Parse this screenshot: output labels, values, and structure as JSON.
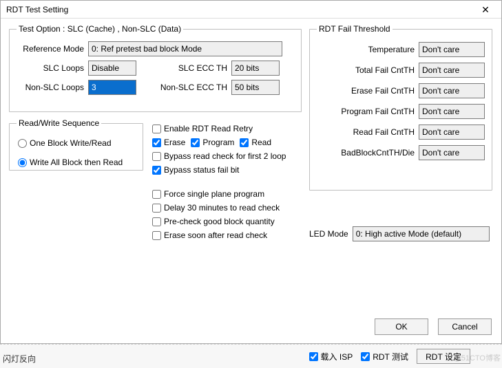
{
  "titlebar": {
    "title": "RDT Test Setting"
  },
  "grp_test_option": {
    "legend": "Test Option :   SLC (Cache)  ,   Non-SLC (Data)",
    "reference_mode_label": "Reference Mode",
    "reference_mode_value": "0: Ref pretest bad block Mode",
    "slc_loops_label": "SLC Loops",
    "slc_loops_value": "Disable",
    "slc_ecc_th_label": "SLC ECC TH",
    "slc_ecc_th_value": "20 bits",
    "nonslc_loops_label": "Non-SLC Loops",
    "nonslc_loops_value": "3",
    "nonslc_ecc_th_label": "Non-SLC ECC TH",
    "nonslc_ecc_th_value": "50 bits"
  },
  "grp_rw": {
    "legend": "Read/Write Sequence",
    "opt1": "One Block Write/Read",
    "opt2": "Write All Block then Read"
  },
  "mid": {
    "enable_retry": "Enable RDT Read Retry",
    "erase": "Erase",
    "program": "Program",
    "read": "Read",
    "bypass_first2": "Bypass read check for first 2 loop",
    "bypass_statusfail": "Bypass status fail bit",
    "force_single_plane": "Force single plane program",
    "delay30": "Delay 30 minutes to read check",
    "precheck_good": "Pre-check good block quantity",
    "erase_soon": "Erase soon after read check"
  },
  "grp_fail": {
    "legend": "RDT Fail Threshold",
    "rows": {
      "temperature": {
        "label": "Temperature",
        "value": "Don't care"
      },
      "totalfail": {
        "label": "Total Fail CntTH",
        "value": "Don't care"
      },
      "erasefail": {
        "label": "Erase Fail CntTH",
        "value": "Don't care"
      },
      "programfail": {
        "label": "Program Fail CntTH",
        "value": "Don't care"
      },
      "readfail": {
        "label": "Read Fail CntTH",
        "value": "Don't care"
      },
      "badblock": {
        "label": "BadBlockCntTH/Die",
        "value": "Don't care"
      }
    }
  },
  "led": {
    "label": "LED Mode",
    "value": "0: High active Mode (default)"
  },
  "buttons": {
    "ok": "OK",
    "cancel": "Cancel"
  },
  "parent": {
    "left_text": "闪灯反向",
    "load_isp": "载入 ISP",
    "rdt_test": "RDT 测试",
    "rdt_set_btn": "RDT 设定",
    "watermark": "@51CTO博客"
  }
}
